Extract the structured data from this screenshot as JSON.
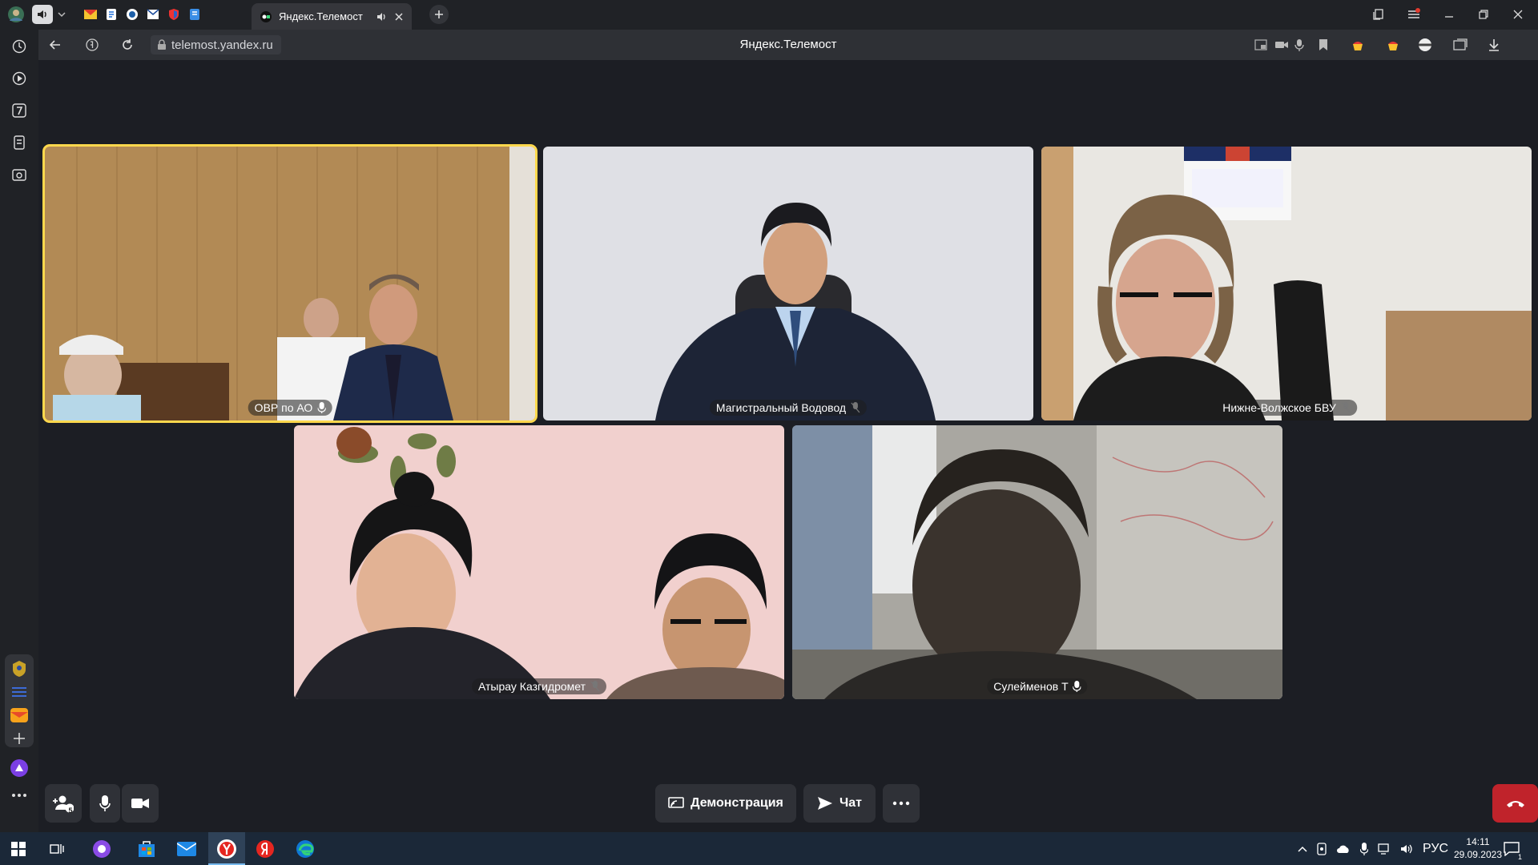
{
  "browser": {
    "active_tab": {
      "title": "Яндекс.Телемост",
      "audio_icon": "speaker-icon",
      "close_icon": "close-icon"
    },
    "pinned_tabs": [
      "mail-icon",
      "document-icon",
      "compass-icon",
      "shield-mail-icon",
      "shield-icon",
      "document-blue-icon"
    ],
    "window_controls": [
      "collections-icon",
      "menu-icon",
      "minimize-icon",
      "restore-icon",
      "close-icon"
    ]
  },
  "address_bar": {
    "url": "telemost.yandex.ru",
    "page_title": "Яндекс.Телемост"
  },
  "sidebar": {
    "items": [
      "history-icon",
      "play-icon",
      "calendar-7-icon",
      "notes-icon",
      "screenshot-icon"
    ],
    "bottom": [
      "gerb-icon",
      "list-icon",
      "mail-icon",
      "add-icon",
      "alice-icon",
      "more-icon"
    ]
  },
  "participants": [
    {
      "name": "ОВР по АО",
      "mic": "on",
      "active": true
    },
    {
      "name": "Магистральный Водовод",
      "mic": "off",
      "active": false
    },
    {
      "name": "Нижне-Волжское БВУ",
      "mic": "off",
      "active": false
    },
    {
      "name": "Атырау Казгидромет",
      "mic": "off",
      "active": false
    },
    {
      "name": "Сулейменов Т",
      "mic": "on",
      "active": false
    }
  ],
  "controls": {
    "invite_count": "5",
    "demo_label": "Демонстрация",
    "chat_label": "Чат"
  },
  "taskbar": {
    "language": "РУС",
    "time": "14:11",
    "date": "29.09.2023",
    "notification_count": "1"
  },
  "colors": {
    "active_speaker": "#ffd84d",
    "end_call": "#c0232b",
    "alice": "#7b3fe4"
  }
}
